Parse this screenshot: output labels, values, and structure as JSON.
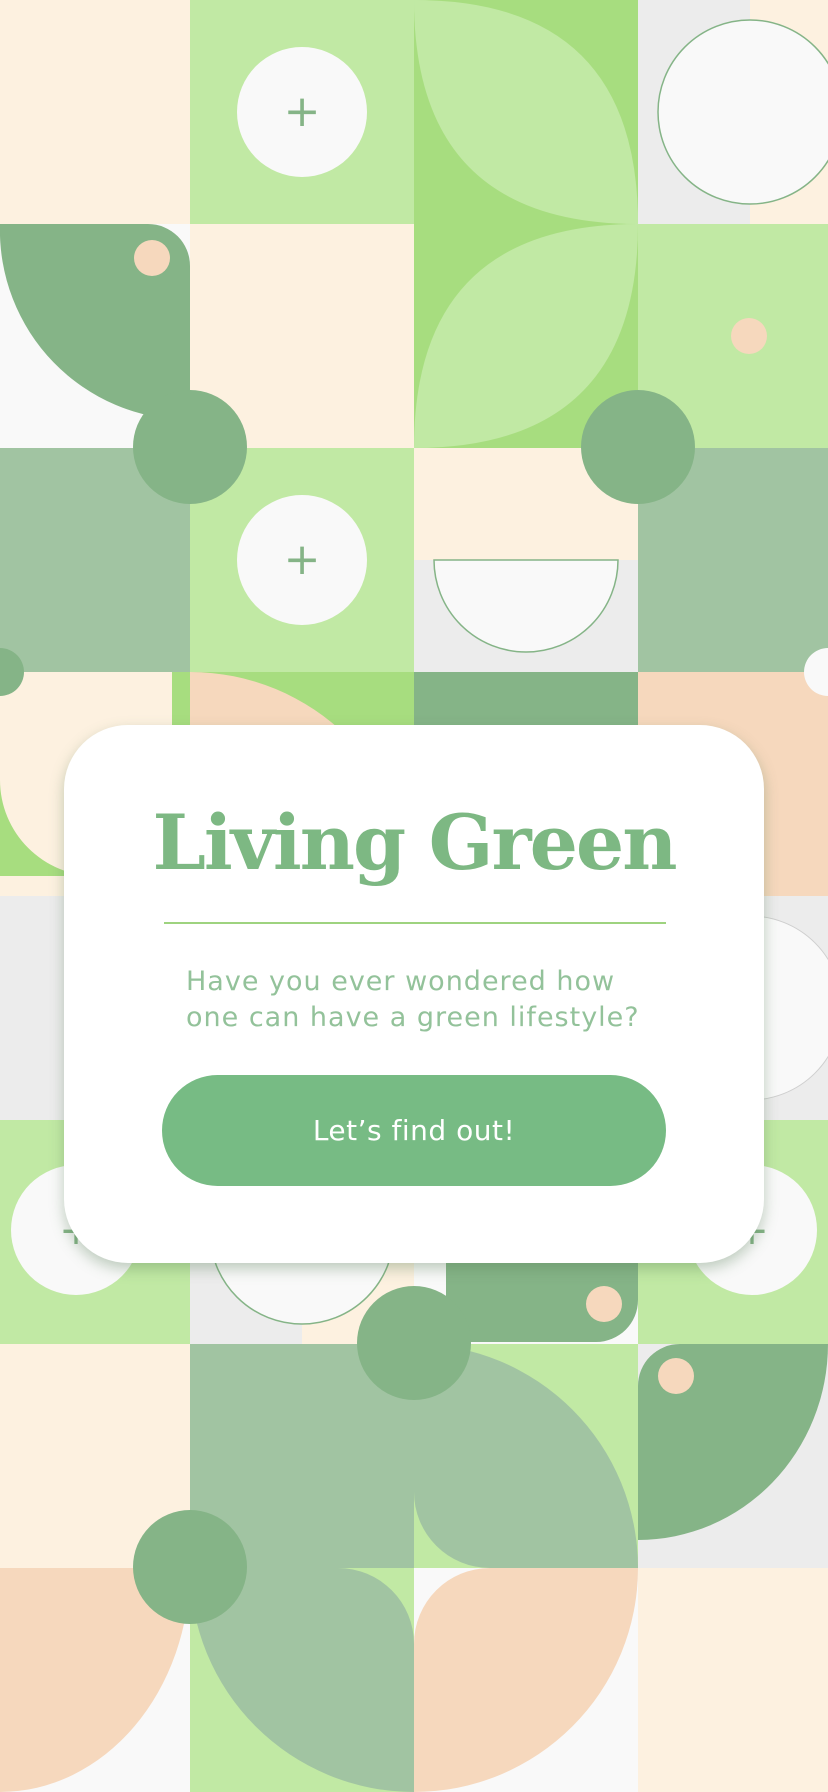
{
  "colors": {
    "cream": "#fdf1e0",
    "mint": "#c1e9a4",
    "grass": "#a7dd7f",
    "sage": "#85b487",
    "sage_light": "#a1c4a2",
    "peach": "#f6d8bd",
    "offwhite": "#f9f9f9",
    "grey": "#ececec",
    "accent": "#77bb84",
    "title": "#7db883",
    "subtitle": "#93c29a"
  },
  "decor": {
    "plus_icon": "plus-icon",
    "plus_glyph": "+"
  },
  "card": {
    "title": "Living Green",
    "subtitle": "Have you ever wondered how one can have a green lifestyle?",
    "cta_label": "Let’s find out!"
  }
}
